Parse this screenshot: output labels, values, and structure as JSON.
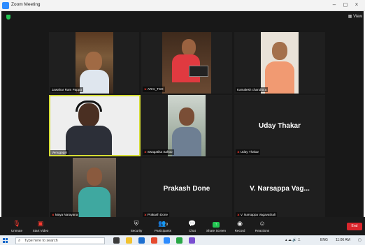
{
  "window": {
    "title": "Zoom Meeting",
    "minimize": "–",
    "maximize": "◻",
    "close": "×"
  },
  "stage": {
    "view_label": "▦ View"
  },
  "participants": [
    {
      "name": "Jawahar Ram Pappu",
      "muted": false,
      "video": true
    },
    {
      "name": "ARAI_TSO",
      "muted": true,
      "video": true
    },
    {
      "name": "Kamalesh chandra a",
      "muted": false,
      "video": true
    },
    {
      "name": "Venugopal",
      "muted": false,
      "video": true,
      "active": true
    },
    {
      "name": "Swagatika Sahoo",
      "muted": true,
      "video": true
    },
    {
      "name": "Uday Thakar",
      "muted": true,
      "video": false,
      "display_name": "Uday Thakar"
    },
    {
      "name": "Maya Narayana",
      "muted": true,
      "video": true
    },
    {
      "name": "Prakash Done",
      "muted": true,
      "video": false,
      "display_name": "Prakash Done"
    },
    {
      "name": "V. Narsappa Vagavathali",
      "muted": true,
      "video": false,
      "display_name": "V. Narsappa Vag..."
    }
  ],
  "toolbar": {
    "unmute": "Unmute",
    "start_video": "Start Video",
    "security": "Security",
    "participants": "Participants",
    "participants_count": "9",
    "chat": "Chat",
    "share_screen": "Share Screen",
    "record": "Record",
    "reactions": "Reactions",
    "end": "End"
  },
  "taskbar": {
    "search_placeholder": "Type here to search",
    "language": "ENG",
    "time": "11:06 AM"
  },
  "colors": {
    "active_speaker": "#d6dd35",
    "share_green": "#23c552",
    "end_red": "#d9262c"
  }
}
